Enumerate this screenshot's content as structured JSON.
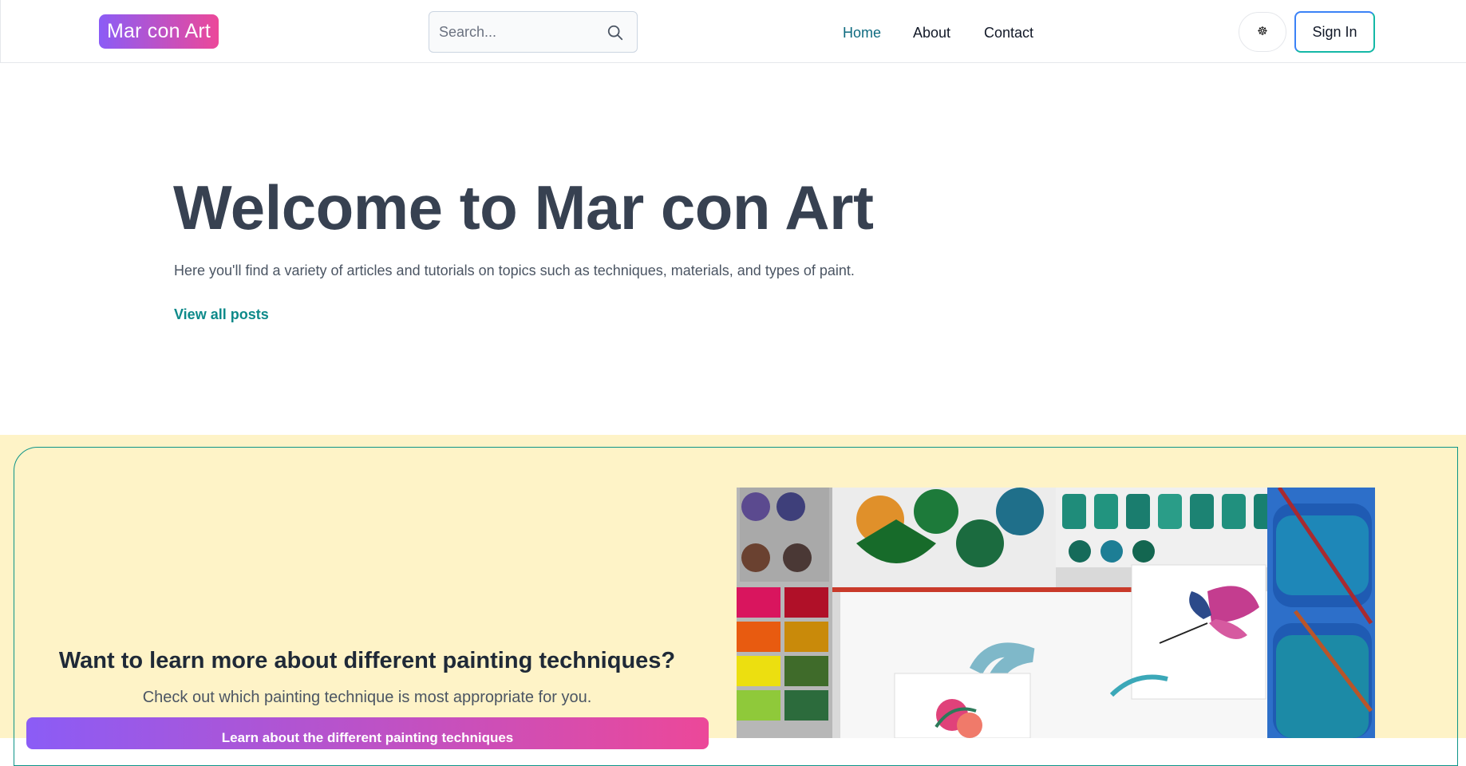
{
  "header": {
    "logo": "Mar con Art",
    "search_placeholder": "Search...",
    "nav": [
      {
        "label": "Home",
        "active": true
      },
      {
        "label": "About",
        "active": false
      },
      {
        "label": "Contact",
        "active": false
      }
    ],
    "theme_icon": "☸",
    "signin_label": "Sign In"
  },
  "hero": {
    "title": "Welcome to Mar con Art",
    "subtitle": "Here you'll find a variety of articles and tutorials on topics such as techniques, materials, and types of paint.",
    "link": "View all posts"
  },
  "feature": {
    "question": "Want to learn more about different painting techniques?",
    "subtitle": "Check out which painting technique is most appropriate for you.",
    "button": "Learn about the different painting techniques"
  },
  "colors": {
    "brand_gradient_start": "#8b5cf6",
    "brand_gradient_end": "#ec4899",
    "accent": "#0e8a8a",
    "feature_bg": "#fef3c7"
  }
}
